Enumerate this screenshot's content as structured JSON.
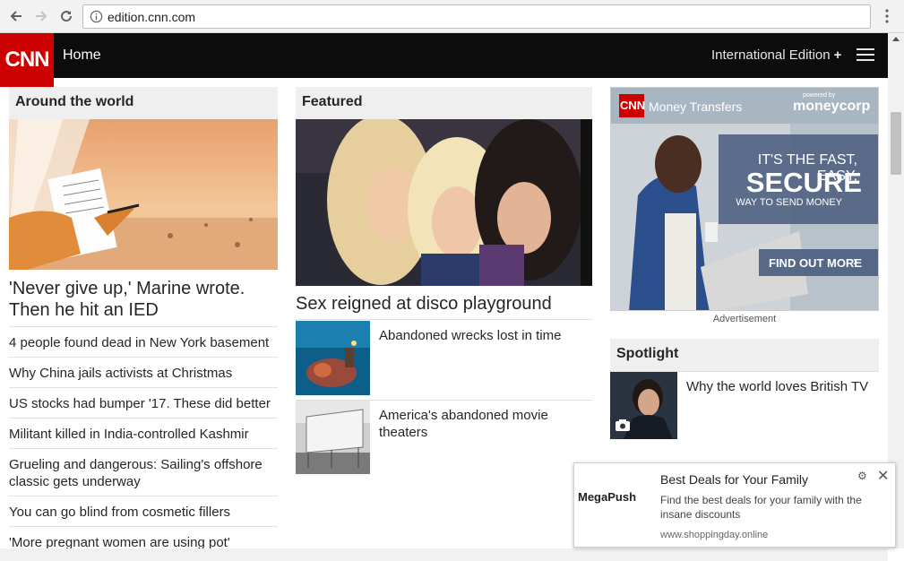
{
  "browser": {
    "url": "edition.cnn.com"
  },
  "header": {
    "logo_text": "CNN",
    "home_label": "Home",
    "edition_label": "International Edition",
    "edition_plus": "+"
  },
  "around_world": {
    "title": "Around the world",
    "lead_headline": "'Never give up,' Marine wrote. Then he hit an IED",
    "items": [
      "4 people found dead in New York basement",
      "Why China jails activists at Christmas",
      "US stocks had bumper '17. These did better",
      "Militant killed in India-controlled Kashmir",
      "Grueling and dangerous: Sailing's offshore classic gets underway",
      "You can go blind from cosmetic fillers",
      "'More pregnant women are using pot'"
    ]
  },
  "featured": {
    "title": "Featured",
    "lead_headline": "Sex reigned at disco playground",
    "stories": [
      "Abandoned wrecks lost in time",
      "America's abandoned movie theaters"
    ]
  },
  "ad": {
    "brand": "CNN",
    "product": "Money Transfers",
    "partner_small": "powered by",
    "partner": "moneycorp",
    "tagline_1": "IT'S THE FAST, EASY,",
    "tagline_2": "SECURE",
    "tagline_3": "WAY TO SEND MONEY",
    "cta": "FIND OUT MORE",
    "label": "Advertisement"
  },
  "spotlight": {
    "title": "Spotlight",
    "story": "Why the world loves British TV"
  },
  "popup": {
    "logo": "MegaPush",
    "title": "Best Deals for Your Family",
    "body": "Find the best deals for your family with the insane discounts",
    "url": "www.shoppingday.online"
  },
  "colors": {
    "cnn_red": "#cc0000",
    "header_bg": "#0c0c0c",
    "section_bg": "#efefef"
  }
}
